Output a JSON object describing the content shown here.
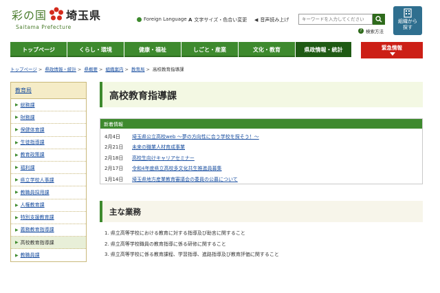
{
  "header": {
    "logo_char1": "彩の国",
    "logo_char2": "埼玉県",
    "logo_sub": "Saitama Prefecture",
    "foreign_language": "Foreign Language",
    "text_size_color": "文字サイズ・色合い変更",
    "read_aloud": "音声読み上げ",
    "search_placeholder": "キーワードを入力してください",
    "search_help": "検索方法",
    "org_button_line1": "組織から",
    "org_button_line2": "探す"
  },
  "nav": {
    "items": [
      {
        "label": "トップページ"
      },
      {
        "label": "くらし・環境"
      },
      {
        "label": "健康・福祉"
      },
      {
        "label": "しごと・産業"
      },
      {
        "label": "文化・教育"
      },
      {
        "label": "県政情報・統計"
      }
    ],
    "emergency": "緊急情報"
  },
  "breadcrumb": {
    "items": [
      "トップページ",
      "県政情報・統計",
      "県概要",
      "組織案内",
      "教育局"
    ],
    "current": "高校教育指導課"
  },
  "sidebar": {
    "heading": "教育局",
    "items": [
      "総務課",
      "財務課",
      "保健体育課",
      "生徒指導課",
      "教育政策課",
      "福利課",
      "県立学校人事課",
      "教職員採用課",
      "人権教育課",
      "特別支援教育課",
      "義務教育指導課",
      "高校教育指導課",
      "教職員課"
    ],
    "current_index": 11
  },
  "main": {
    "title": "高校教育指導課",
    "news_heading": "新着情報",
    "news": [
      {
        "date": "4月4日",
        "text": "埼玉県公立高校web ～夢の方向性に合う学校を探そう！～"
      },
      {
        "date": "2月21日",
        "text": "未来の職業人材育成事業"
      },
      {
        "date": "2月18日",
        "text": "高校生向けキャリアセミナー"
      },
      {
        "date": "2月17日",
        "text": "令和4年度県立高校多文化共生推進員募集"
      },
      {
        "date": "1月14日",
        "text": "埼玉県地方産業教育審議会の委員の公募について"
      }
    ],
    "section_title": "主な業務",
    "duties": [
      "1. 県立高等学校における教育に対する指導及び助言に関すること",
      "2. 県立高等学校職員の教育指導に係る研修に関すること",
      "3. 県立高等学校に係る教育課程、学習指導、進路指導及び教育評価に関すること"
    ]
  },
  "colors": {
    "nav_green": "#3e8a2e",
    "nav_active": "#1f5a14",
    "emergency_red": "#cc1f16",
    "link_blue": "#1a4fa0",
    "org_button": "#2f6f8f"
  }
}
